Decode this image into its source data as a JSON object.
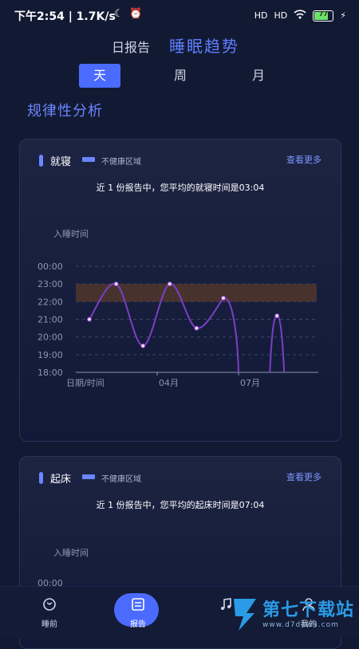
{
  "status": {
    "time_speed": "下午2:54 | 1.7K/s",
    "battery_level": "77",
    "signal_label_1": "HD",
    "signal_label_2": "HD"
  },
  "header": {
    "daily_report": "日报告",
    "sleep_trend": "睡眠趋势"
  },
  "period_tabs": {
    "day": "天",
    "week": "周",
    "month": "月"
  },
  "section_title": "规律性分析",
  "cards": {
    "bedtime": {
      "title": "就寝",
      "legend": "不健康区域",
      "more": "查看更多",
      "summary": "近 1 份报告中，您平均的就寝时间是03:04",
      "y_axis_title": "入睡时间",
      "y_ticks": [
        "00:00",
        "23:00",
        "22:00",
        "21:00",
        "20:00",
        "19:00",
        "18:00"
      ],
      "x_ticks": [
        "日期/时间",
        "04月",
        "07月"
      ]
    },
    "wake": {
      "title": "起床",
      "legend": "不健康区域",
      "more": "查看更多",
      "summary": "近 1 份报告中，您平均的起床时间是07:04",
      "y_axis_title": "入睡时间",
      "y_ticks": [
        "00:00"
      ]
    }
  },
  "chart_data": {
    "type": "line",
    "y_axis": "time of day (hours)",
    "ylim": [
      18,
      24
    ],
    "unhealthy_band": [
      22,
      23
    ],
    "series": [
      {
        "values": [
          {
            "x": 0,
            "y": 21.0
          },
          {
            "x": 1,
            "y": 23.0
          },
          {
            "x": 2,
            "y": 19.5
          },
          {
            "x": 3,
            "y": 23.0
          },
          {
            "x": 4,
            "y": 20.5
          },
          {
            "x": 5,
            "y": 22.2
          },
          {
            "x": 7,
            "y": 21.2
          }
        ]
      }
    ],
    "x_ticks": [
      "日期/时间",
      "04月",
      "07月"
    ]
  },
  "bottom_nav": {
    "items": [
      {
        "label": "睡前"
      },
      {
        "label": "报告"
      },
      {
        "label": ""
      },
      {
        "label": "我的"
      }
    ]
  },
  "watermark": {
    "name": "第七下载站",
    "url": "www.d7down.com"
  },
  "colors": {
    "accent": "#4b6bff",
    "line": "#7b3fc4",
    "band": "#5a3a2a",
    "background": "#121a33"
  }
}
